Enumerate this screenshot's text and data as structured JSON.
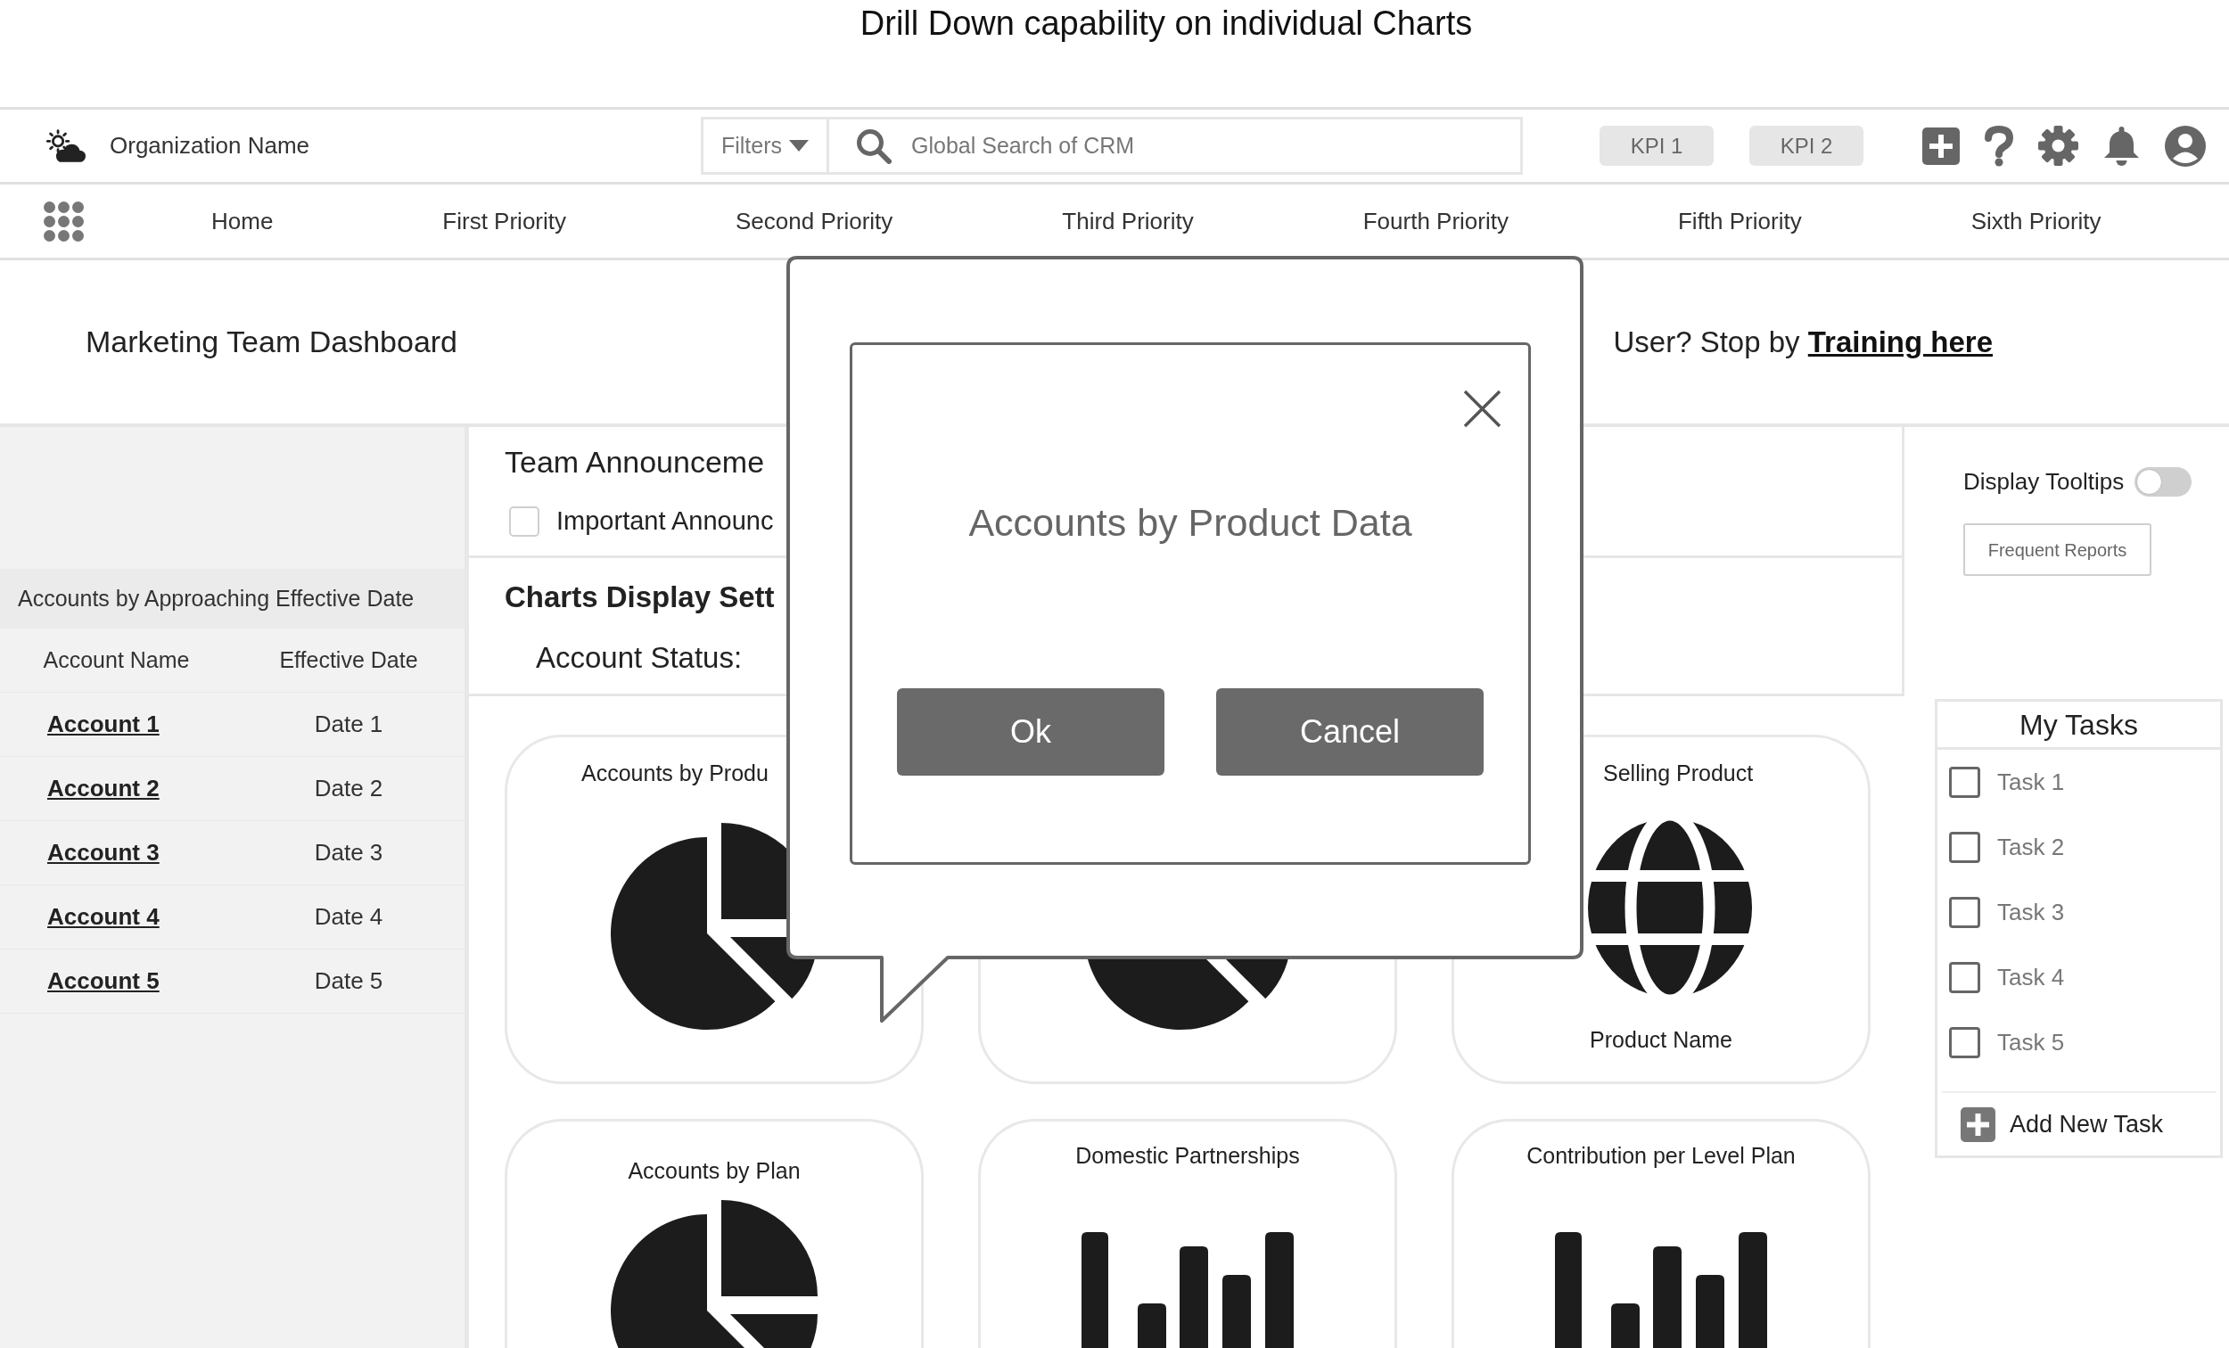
{
  "page_title": "Drill Down capability on individual Charts",
  "header": {
    "org_name": "Organization Name",
    "filters": "Filters",
    "search": {
      "placeholder": "Global Search of CRM"
    },
    "kpis": [
      "KPI 1",
      "KPI 2"
    ]
  },
  "nav": {
    "items": [
      "Home",
      "First Priority",
      "Second Priority",
      "Third Priority",
      "Fourth Priority",
      "Fifth Priority",
      "Sixth Priority"
    ]
  },
  "banner": {
    "title": "Marketing Team Dashboard",
    "training_text": "User? Stop by",
    "training_link": "Training here"
  },
  "sidebar": {
    "title": "Accounts by Approaching Effective Date",
    "columns": [
      "Account Name",
      "Effective Date"
    ],
    "rows": [
      {
        "account": "Account 1",
        "date": "Date 1"
      },
      {
        "account": "Account 2",
        "date": "Date 2"
      },
      {
        "account": "Account 3",
        "date": "Date 3"
      },
      {
        "account": "Account 4",
        "date": "Date 4"
      },
      {
        "account": "Account 5",
        "date": "Date 5"
      }
    ]
  },
  "announcements": {
    "title": "Team Announceme",
    "items": [
      {
        "label": "Important Announc",
        "checked": false
      }
    ]
  },
  "chart_settings": {
    "title": "Charts Display Sett",
    "field_label": "Account Status:"
  },
  "chart_cards": [
    {
      "title": "Accounts by Produ",
      "kind": "pie"
    },
    {
      "kind": "pie"
    },
    {
      "title": "Selling Product",
      "kind": "globe",
      "caption": "Product Name"
    },
    {
      "title": "Accounts by Plan",
      "kind": "pie"
    },
    {
      "title": "Domestic Partnerships",
      "kind": "bars"
    },
    {
      "title": "Contribution per Level Plan",
      "kind": "bars"
    }
  ],
  "right_panel": {
    "tooltips": {
      "label": "Display Tooltips",
      "on": false
    },
    "frequent_reports": "Frequent Reports",
    "tasks": {
      "title": "My Tasks",
      "items": [
        {
          "label": "Task 1",
          "checked": false
        },
        {
          "label": "Task 2",
          "checked": false
        },
        {
          "label": "Task 3",
          "checked": false
        },
        {
          "label": "Task 4",
          "checked": false
        },
        {
          "label": "Task 5",
          "checked": false
        }
      ],
      "add_label": "Add New Task"
    }
  },
  "dialog": {
    "title": "Accounts by Product Data",
    "buttons": [
      "Ok",
      "Cancel"
    ]
  }
}
